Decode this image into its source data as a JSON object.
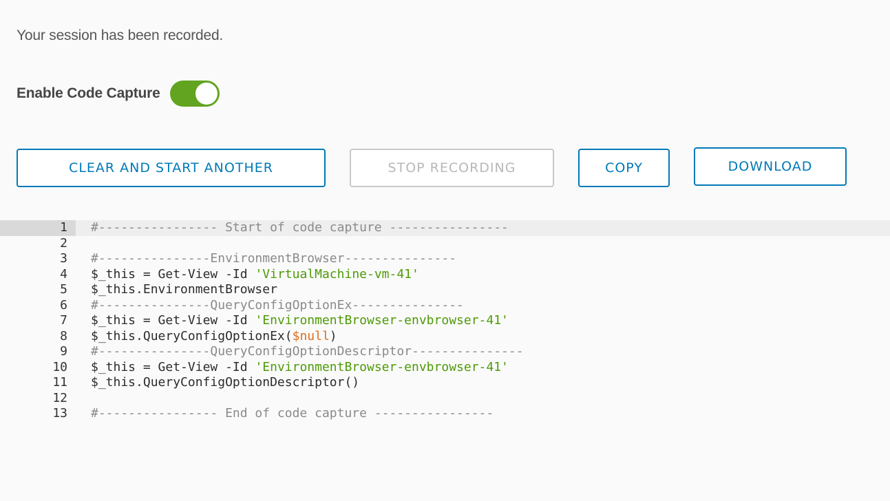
{
  "session": {
    "status_text": "Your session has been recorded."
  },
  "code_capture": {
    "label": "Enable Code Capture",
    "enabled": true,
    "toggle_color": "#62a420"
  },
  "buttons": {
    "clear_label": "CLEAR AND START ANOTHER",
    "stop_label": "STOP RECORDING",
    "stop_disabled": true,
    "copy_label": "COPY",
    "download_label": "DOWNLOAD",
    "accent_color": "#0079b8"
  },
  "editor": {
    "active_line": 1,
    "lines": [
      {
        "num": "1",
        "tokens": [
          {
            "t": "comment",
            "v": "#---------------- Start of code capture ----------------"
          }
        ]
      },
      {
        "num": "2",
        "tokens": []
      },
      {
        "num": "3",
        "tokens": [
          {
            "t": "comment",
            "v": "#---------------EnvironmentBrowser---------------"
          }
        ]
      },
      {
        "num": "4",
        "tokens": [
          {
            "t": "var",
            "v": "$_this"
          },
          {
            "t": "op",
            "v": " = "
          },
          {
            "t": "cmd",
            "v": "Get-View"
          },
          {
            "t": "param",
            "v": " -Id "
          },
          {
            "t": "string",
            "v": "'VirtualMachine-vm-41'"
          }
        ]
      },
      {
        "num": "5",
        "tokens": [
          {
            "t": "var",
            "v": "$_this.EnvironmentBrowser"
          }
        ]
      },
      {
        "num": "6",
        "tokens": [
          {
            "t": "comment",
            "v": "#---------------QueryConfigOptionEx---------------"
          }
        ]
      },
      {
        "num": "7",
        "tokens": [
          {
            "t": "var",
            "v": "$_this"
          },
          {
            "t": "op",
            "v": " = "
          },
          {
            "t": "cmd",
            "v": "Get-View"
          },
          {
            "t": "param",
            "v": " -Id "
          },
          {
            "t": "string",
            "v": "'EnvironmentBrowser-envbrowser-41'"
          }
        ]
      },
      {
        "num": "8",
        "tokens": [
          {
            "t": "var",
            "v": "$_this.QueryConfigOptionEx("
          },
          {
            "t": "null",
            "v": "$null"
          },
          {
            "t": "var",
            "v": ")"
          }
        ]
      },
      {
        "num": "9",
        "tokens": [
          {
            "t": "comment",
            "v": "#---------------QueryConfigOptionDescriptor---------------"
          }
        ]
      },
      {
        "num": "10",
        "tokens": [
          {
            "t": "var",
            "v": "$_this"
          },
          {
            "t": "op",
            "v": " = "
          },
          {
            "t": "cmd",
            "v": "Get-View"
          },
          {
            "t": "param",
            "v": " -Id "
          },
          {
            "t": "string",
            "v": "'EnvironmentBrowser-envbrowser-41'"
          }
        ]
      },
      {
        "num": "11",
        "tokens": [
          {
            "t": "var",
            "v": "$_this.QueryConfigOptionDescriptor()"
          }
        ]
      },
      {
        "num": "12",
        "tokens": []
      },
      {
        "num": "13",
        "tokens": [
          {
            "t": "comment",
            "v": "#---------------- End of code capture ----------------"
          }
        ]
      }
    ]
  }
}
